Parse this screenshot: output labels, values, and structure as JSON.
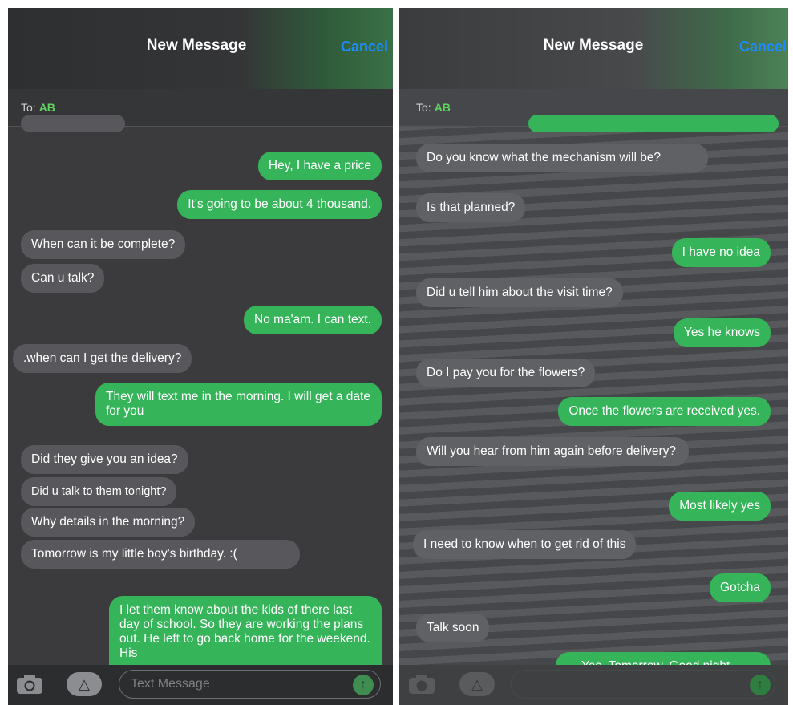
{
  "colors": {
    "incoming_bubble": "#58585c",
    "outgoing_bubble": "#35b45a",
    "cancel_link": "#1a8cff",
    "recipient": "#5fd35f"
  },
  "left": {
    "header": {
      "title": "New Message",
      "cancel_label": "Cancel"
    },
    "to": {
      "label": "To:",
      "recipient": "AB"
    },
    "messages": [
      {
        "dir": "out",
        "text": "Hey, I have a price"
      },
      {
        "dir": "out",
        "text": "It's going to be about 4 thousand."
      },
      {
        "dir": "in",
        "text": "When can it be complete?"
      },
      {
        "dir": "in",
        "text": "Can u talk?"
      },
      {
        "dir": "out",
        "text": "No ma'am. I can text."
      },
      {
        "dir": "in",
        "text": ".when can I get the delivery?"
      },
      {
        "dir": "out",
        "text": "They will text me in the morning. I will get a date for you"
      },
      {
        "dir": "in",
        "text": "Did they give you an idea?"
      },
      {
        "dir": "in",
        "text": "Did u talk to them tonight?"
      },
      {
        "dir": "in",
        "text": "Why details in the morning?"
      },
      {
        "dir": "in",
        "text": "Tomorrow is my little boy's birthday. :("
      },
      {
        "dir": "out",
        "text": "I let them know about the kids of there last day of school. So they are working the plans out. He left to go back home for the weekend. His"
      }
    ],
    "composer": {
      "placeholder": "Text Message",
      "camera_icon": "camera-icon",
      "appstore_icon": "app-store-icon",
      "send_icon": "send-arrow-icon"
    }
  },
  "right": {
    "header": {
      "title": "New Message",
      "cancel_label": "Cancel"
    },
    "to": {
      "label": "To:",
      "recipient": "AB"
    },
    "messages": [
      {
        "dir": "in",
        "text": "Do you know what the mechanism will be?"
      },
      {
        "dir": "in",
        "text": "Is that planned?"
      },
      {
        "dir": "out",
        "text": "I have no idea"
      },
      {
        "dir": "in",
        "text": "Did u tell him about the visit time?"
      },
      {
        "dir": "out",
        "text": "Yes he knows"
      },
      {
        "dir": "in",
        "text": "Do I pay you for the flowers?"
      },
      {
        "dir": "out",
        "text": "Once the flowers are received yes."
      },
      {
        "dir": "in",
        "text": "Will you hear from him again before delivery?"
      },
      {
        "dir": "out",
        "text": "Most likely yes"
      },
      {
        "dir": "in",
        "text": "I need to know when to get rid of this"
      },
      {
        "dir": "out",
        "text": "Gotcha"
      },
      {
        "dir": "in",
        "text": "Talk soon"
      },
      {
        "dir": "out",
        "text": "Yes. Tomorrow. Good night"
      }
    ],
    "composer": {
      "placeholder": "",
      "camera_icon": "camera-icon",
      "appstore_icon": "app-store-icon",
      "send_icon": "send-arrow-icon"
    }
  }
}
